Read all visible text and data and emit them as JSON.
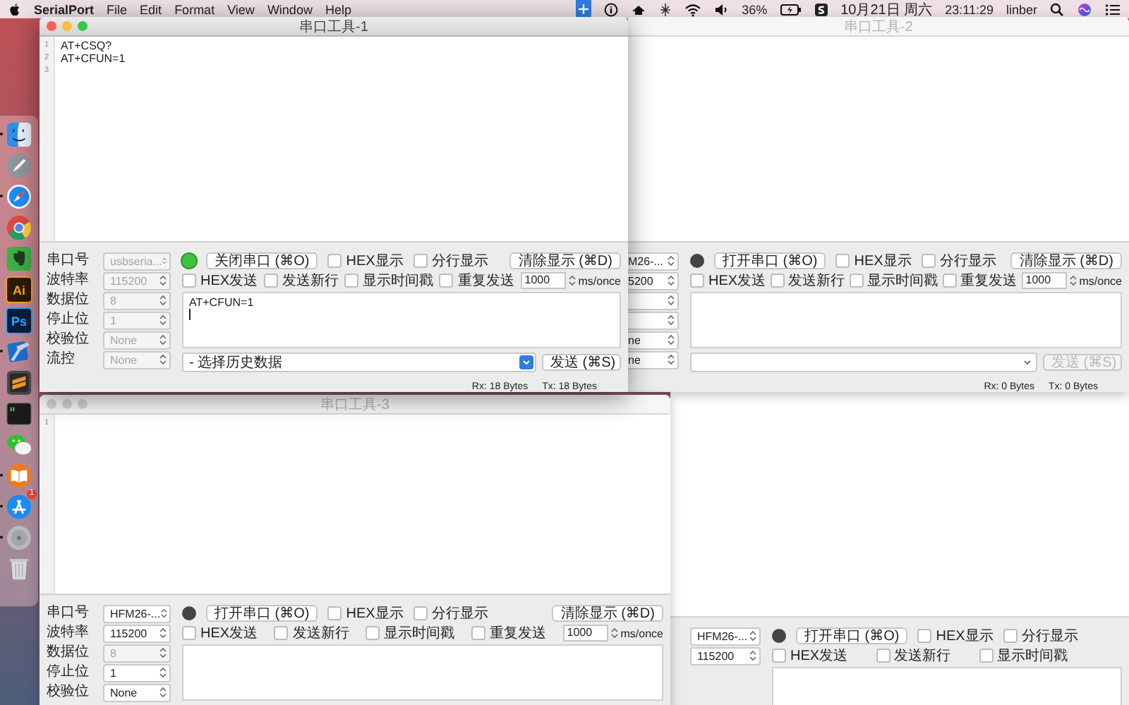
{
  "menu_bar": {
    "app_name": "SerialPort",
    "menus": [
      "File",
      "Edit",
      "Format",
      "View",
      "Window",
      "Help"
    ],
    "battery": "36%",
    "date": "10月21日 周六",
    "time": "23:11:29",
    "user": "linber"
  },
  "dock": [
    {
      "kind": "finder",
      "running": true
    },
    {
      "kind": "launchpad"
    },
    {
      "kind": "safari",
      "running": true
    },
    {
      "kind": "chrome"
    },
    {
      "kind": "evernote"
    },
    {
      "kind": "illustrator",
      "label": "Ai"
    },
    {
      "kind": "photoshop",
      "label": "Ps"
    },
    {
      "kind": "xcode",
      "running": true
    },
    {
      "kind": "sublime"
    },
    {
      "kind": "terminal"
    },
    {
      "kind": "wechat"
    },
    {
      "kind": "ibooks",
      "running": true
    },
    {
      "kind": "appstore",
      "running": true,
      "badge": "1"
    },
    {
      "kind": "disk",
      "running": true
    },
    {
      "kind": "trash"
    }
  ],
  "windows": [
    {
      "title": "串口工具-1",
      "active": true,
      "editor": [
        {
          "number": "1",
          "text": "AT+CSQ?"
        },
        {
          "number": "2",
          "text": "AT+CFUN=1"
        },
        {
          "number": "3"
        }
      ],
      "settings": [
        {
          "label": "串口号",
          "value": "usbseria...",
          "disabled": true
        },
        {
          "label": "波特率",
          "value": "115200",
          "disabled": true
        },
        {
          "label": "数据位",
          "value": "8",
          "disabled": true
        },
        {
          "label": "停止位",
          "value": "1",
          "disabled": true
        },
        {
          "label": "校验位",
          "value": "None",
          "disabled": true
        },
        {
          "label": "流控",
          "value": "None",
          "disabled": true
        }
      ],
      "connected": true,
      "toggle_button": "关闭串口 (⌘O)",
      "display_options": [
        {
          "label": "HEX显示",
          "checked": false
        },
        {
          "label": "分行显示",
          "checked": false
        }
      ],
      "clear_button": "清除显示 (⌘D)",
      "send_options": [
        {
          "label": "HEX发送",
          "checked": false
        },
        {
          "label": "发送新行",
          "checked": false
        },
        {
          "label": "显示时间戳",
          "checked": false
        },
        {
          "label": "重复发送",
          "checked": false
        }
      ],
      "interval": "1000",
      "interval_unit": "ms/once",
      "send_text": "AT+CFUN=1",
      "send_focused": true,
      "history_placeholder": "- 选择历史数据",
      "send_button": {
        "label": "发送 (⌘S)",
        "disabled": false
      },
      "rx": "Rx: 18 Bytes",
      "tx": "Tx: 18 Bytes"
    },
    {
      "title": "串口工具-2",
      "active": false,
      "settings": [
        {
          "value": "M26-...",
          "disabled": false
        },
        {
          "value": "5200",
          "disabled": false
        },
        {
          "disabled": false
        },
        {
          "disabled": false
        },
        {
          "value": "ne",
          "disabled": false
        },
        {
          "value": "ne",
          "disabled": false
        }
      ],
      "connected": false,
      "toggle_button": "打开串口 (⌘O)",
      "display_options": [
        {
          "label": "HEX显示",
          "checked": false
        },
        {
          "label": "分行显示",
          "checked": false
        }
      ],
      "clear_button": "清除显示 (⌘D)",
      "send_options": [
        {
          "label": "HEX发送",
          "checked": false
        },
        {
          "label": "发送新行",
          "checked": false
        },
        {
          "label": "显示时间戳",
          "checked": false
        },
        {
          "label": "重复发送",
          "checked": false
        }
      ],
      "interval": "1000",
      "interval_unit": "ms/once",
      "send_button": {
        "label": "发送 (⌘S)",
        "disabled": true
      },
      "rx": "Rx: 0 Bytes",
      "tx": "Tx: 0 Bytes"
    },
    {
      "title": "串口工具-3",
      "active": false,
      "editor": [
        {
          "number": "1"
        }
      ],
      "settings": [
        {
          "label": "串口号",
          "value": "HFM26-...",
          "disabled": false
        },
        {
          "label": "波特率",
          "value": "115200",
          "disabled": false
        },
        {
          "label": "数据位",
          "value": "8",
          "disabled": true
        },
        {
          "label": "停止位",
          "value": "1",
          "disabled": false
        },
        {
          "label": "校验位",
          "value": "None",
          "disabled": false
        }
      ],
      "connected": false,
      "toggle_button": "打开串口 (⌘O)",
      "display_options": [
        {
          "label": "HEX显示",
          "checked": false
        },
        {
          "label": "分行显示",
          "checked": false
        }
      ],
      "clear_button": "清除显示 (⌘D)",
      "send_options": [
        {
          "label": "HEX发送",
          "checked": false
        },
        {
          "label": "发送新行",
          "checked": false
        },
        {
          "label": "显示时间戳",
          "checked": false
        },
        {
          "label": "重复发送",
          "checked": false
        }
      ],
      "interval": "1000",
      "interval_unit": "ms/once"
    },
    {
      "settings": [
        {
          "value": "HFM26-...",
          "disabled": false
        },
        {
          "value": "115200",
          "disabled": false
        }
      ],
      "connected": false,
      "toggle_button": "打开串口 (⌘O)",
      "display_options": [
        {
          "label": "HEX显示",
          "checked": false
        },
        {
          "label": "分行显示",
          "checked": false
        }
      ],
      "send_options": [
        {
          "label": "HEX发送",
          "checked": false
        },
        {
          "label": "发送新行",
          "checked": false
        },
        {
          "label": "显示时间戳",
          "checked": false
        }
      ]
    }
  ]
}
